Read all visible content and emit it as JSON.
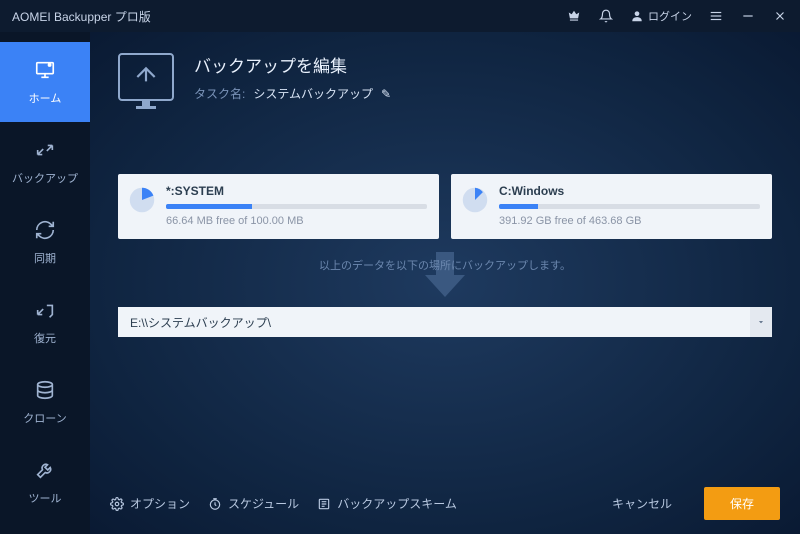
{
  "titlebar": {
    "title": "AOMEI Backupper プロ版",
    "login": "ログイン"
  },
  "sidebar": {
    "items": [
      {
        "label": "ホーム"
      },
      {
        "label": "バックアップ"
      },
      {
        "label": "同期"
      },
      {
        "label": "復元"
      },
      {
        "label": "クローン"
      },
      {
        "label": "ツール"
      }
    ]
  },
  "header": {
    "title": "バックアップを編集",
    "task_label": "タスク名:",
    "task_name": "システムバックアップ"
  },
  "drives": [
    {
      "name": "*:SYSTEM",
      "free": "66.64 MB free of 100.00 MB",
      "pct": 33
    },
    {
      "name": "C:Windows",
      "free": "391.92 GB free of 463.68 GB",
      "pct": 15
    }
  ],
  "arrow_text": "以上のデータを以下の場所にバックアップします。",
  "destination": "E:\\\\システムバックアップ\\",
  "footer": {
    "options": "オプション",
    "schedule": "スケジュール",
    "scheme": "バックアップスキーム",
    "cancel": "キャンセル",
    "save": "保存"
  }
}
